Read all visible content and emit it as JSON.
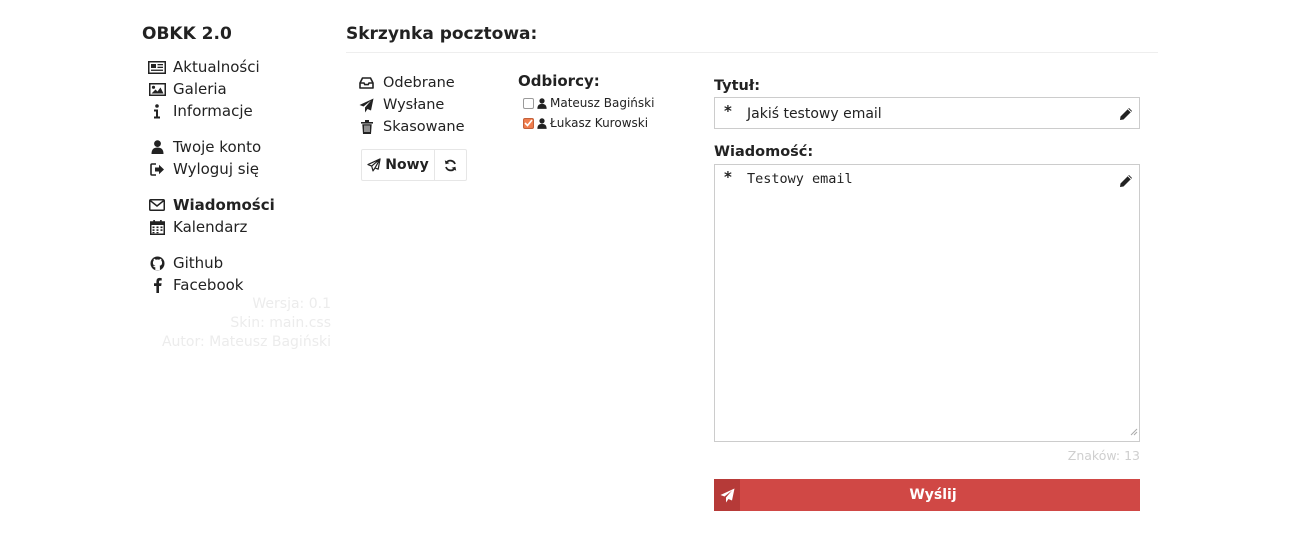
{
  "app": {
    "title": "OBKK 2.0"
  },
  "sidebar": {
    "groups": [
      [
        {
          "label": "Aktualności",
          "icon": "newspaper-icon"
        },
        {
          "label": "Galeria",
          "icon": "image-icon"
        },
        {
          "label": "Informacje",
          "icon": "info-icon"
        }
      ],
      [
        {
          "label": "Twoje konto",
          "icon": "user-icon"
        },
        {
          "label": "Wyloguj się",
          "icon": "sign-out-icon"
        }
      ],
      [
        {
          "label": "Wiadomości",
          "icon": "envelope-icon",
          "active": true
        },
        {
          "label": "Kalendarz",
          "icon": "calendar-icon"
        }
      ],
      [
        {
          "label": "Github",
          "icon": "github-icon"
        },
        {
          "label": "Facebook",
          "icon": "facebook-icon"
        }
      ]
    ]
  },
  "meta": {
    "version": "Wersja: 0.1",
    "skin": "Skin: main.css",
    "author": "Autor: Mateusz Bagiński"
  },
  "main": {
    "title": "Skrzynka pocztowa:",
    "folders": [
      {
        "label": "Odebrane",
        "icon": "inbox-icon"
      },
      {
        "label": "Wysłane",
        "icon": "paper-plane-icon"
      },
      {
        "label": "Skasowane",
        "icon": "trash-icon"
      }
    ],
    "buttons": {
      "new_label": "Nowy"
    },
    "recipients": {
      "title": "Odbiorcy:",
      "items": [
        {
          "name": "Mateusz Bagiński",
          "checked": false
        },
        {
          "name": "Łukasz Kurowski",
          "checked": true
        }
      ]
    },
    "form": {
      "title_label": "Tytuł:",
      "title_value": "Jakiś testowy email",
      "message_label": "Wiadomość:",
      "message_value": "Testowy email",
      "required_marker": "*",
      "char_count": "Znaków: 13",
      "send_label": "Wyślij"
    }
  },
  "colors": {
    "accent": "#d04845",
    "accent_dark": "#b63a38",
    "checkbox": "#f07d4d"
  }
}
